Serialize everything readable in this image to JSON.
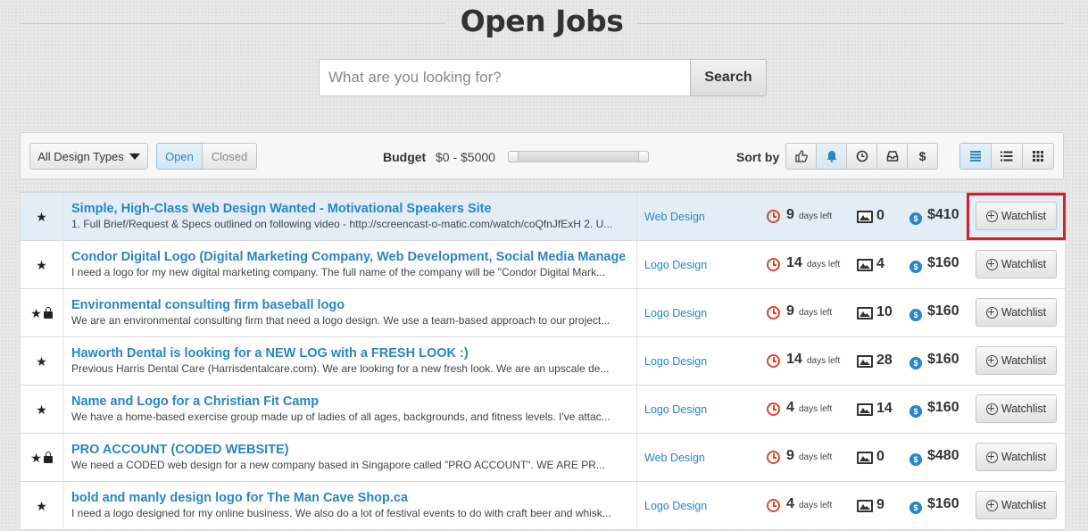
{
  "header": {
    "title": "Open Jobs",
    "search_placeholder": "What are you looking for?",
    "search_button": "Search"
  },
  "filters": {
    "design_types": "All Design Types",
    "status_open": "Open",
    "status_closed": "Closed",
    "budget_label": "Budget",
    "budget_range": "$0 - $5000",
    "sort_label": "Sort by",
    "active_sort": "bell",
    "active_view": "list-detailed"
  },
  "colors": {
    "link_blue": "#2a86c1",
    "clock_red": "#d54a2e",
    "highlight_red": "#e01b24"
  },
  "jobs": [
    {
      "title": "Simple, High-Class Web Design Wanted - Motivational Speakers Site",
      "desc": "1. Full Brief/Request & Specs outlined on following video - http://screencast-o-matic.com/watch/coQfnJfExH 2. U...",
      "category": "Web Design",
      "days": "9",
      "days_label": "days left",
      "entries": "0",
      "price": "$410",
      "watchlist": "Watchlist",
      "locked": false
    },
    {
      "title": "Condor Digital Logo (Digital Marketing Company, Web Development, Social Media Manager",
      "desc": "I need a logo for my new digital marketing company. The full name of the company will be \"Condor Digital Mark...",
      "category": "Logo Design",
      "days": "14",
      "days_label": "days left",
      "entries": "4",
      "price": "$160",
      "watchlist": "Watchlist",
      "locked": false
    },
    {
      "title": "Environmental consulting firm baseball logo",
      "desc": "We are an environmental consulting firm that need a logo design. We use a team-based approach to our project...",
      "category": "Logo Design",
      "days": "9",
      "days_label": "days left",
      "entries": "10",
      "price": "$160",
      "watchlist": "Watchlist",
      "locked": true
    },
    {
      "title": "Haworth Dental is looking for a NEW LOG with a FRESH LOOK :)",
      "desc": "Previous Harris Dental Care (Harrisdentalcare.com). We are looking for a new fresh look. We are an upscale de...",
      "category": "Logo Design",
      "days": "14",
      "days_label": "days left",
      "entries": "28",
      "price": "$160",
      "watchlist": "Watchlist",
      "locked": false
    },
    {
      "title": "Name and Logo for a Christian Fit Camp",
      "desc": "We have a home-based exercise group made up of ladies of all ages, backgrounds, and fitness levels. I've attac...",
      "category": "Logo Design",
      "days": "4",
      "days_label": "days left",
      "entries": "14",
      "price": "$160",
      "watchlist": "Watchlist",
      "locked": false
    },
    {
      "title": "PRO ACCOUNT (CODED WEBSITE)",
      "desc": "We need a CODED web design for a new company based in Singapore called \"PRO ACCOUNT\". WE ARE PR...",
      "category": "Web Design",
      "days": "9",
      "days_label": "days left",
      "entries": "0",
      "price": "$480",
      "watchlist": "Watchlist",
      "locked": true
    },
    {
      "title": "bold and manly design logo for The Man Cave Shop.ca",
      "desc": "I need a logo designed for my online business. We also do a lot of festival events to do with craft beer and whisk...",
      "category": "Logo Design",
      "days": "4",
      "days_label": "days left",
      "entries": "9",
      "price": "$160",
      "watchlist": "Watchlist",
      "locked": false
    }
  ]
}
